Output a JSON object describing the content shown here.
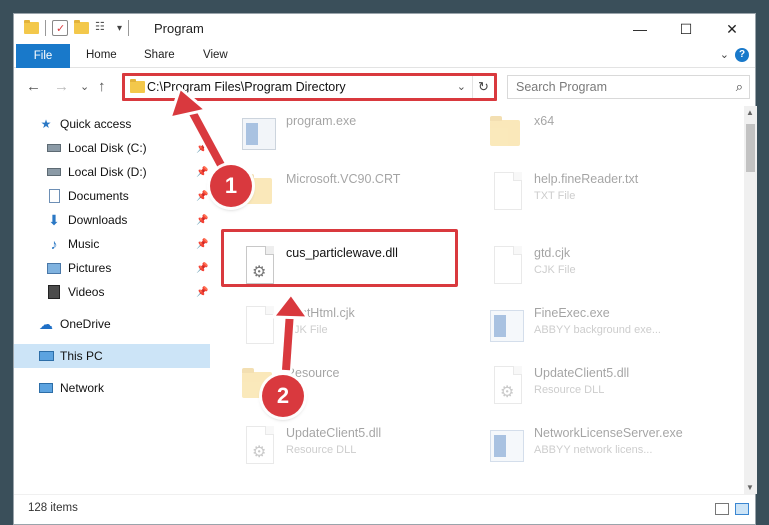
{
  "window": {
    "title": "Program",
    "minimize": "—",
    "maximize": "☐",
    "close": "✕"
  },
  "ribbon": {
    "file": "File",
    "tabs": [
      "Home",
      "Share",
      "View"
    ],
    "collapse": "⌄",
    "help": "?"
  },
  "address": {
    "path": "C:\\Program Files\\Program Directory",
    "back": "←",
    "forward": "→",
    "recent": "⌄",
    "up": "↑",
    "dropdown": "⌄",
    "refresh": "↻"
  },
  "search": {
    "placeholder": "Search Program",
    "icon": "search-icon"
  },
  "sidebar": {
    "items": [
      {
        "label": "Quick access",
        "icon": "star-icon",
        "pinned": false
      },
      {
        "label": "Local Disk (C:)",
        "icon": "drive-icon",
        "pinned": true
      },
      {
        "label": "Local Disk (D:)",
        "icon": "drive-icon",
        "pinned": true
      },
      {
        "label": "Documents",
        "icon": "documents-icon",
        "pinned": true
      },
      {
        "label": "Downloads",
        "icon": "download-icon",
        "pinned": true
      },
      {
        "label": "Music",
        "icon": "music-icon",
        "pinned": true
      },
      {
        "label": "Pictures",
        "icon": "pictures-icon",
        "pinned": true
      },
      {
        "label": "Videos",
        "icon": "videos-icon",
        "pinned": true
      },
      {
        "label": "OneDrive",
        "icon": "cloud-icon",
        "pinned": false
      },
      {
        "label": "This PC",
        "icon": "computer-icon",
        "pinned": false,
        "selected": true
      },
      {
        "label": "Network",
        "icon": "network-icon",
        "pinned": false
      }
    ]
  },
  "files": [
    {
      "name": "program.exe",
      "subtitle": "",
      "icon": "app-icon"
    },
    {
      "name": "x64",
      "subtitle": "",
      "icon": "folder-icon"
    },
    {
      "name": "Microsoft.VC90.CRT",
      "subtitle": "",
      "icon": "folder-icon"
    },
    {
      "name": "help.fineReader.txt",
      "subtitle": "TXT File",
      "icon": "document-icon"
    },
    {
      "name": "cus_particlewave.dll",
      "subtitle": "",
      "icon": "dll-icon"
    },
    {
      "name": "gtd.cjk",
      "subtitle": "CJK File",
      "icon": "document-icon"
    },
    {
      "name": "FastHtml.cjk",
      "subtitle": "CJK File",
      "icon": "document-icon"
    },
    {
      "name": "FineExec.exe",
      "subtitle": "ABBYY background exe...",
      "icon": "app-icon"
    },
    {
      "name": "Resource",
      "subtitle": "",
      "icon": "folder-icon"
    },
    {
      "name": "UpdateClient5.dll",
      "subtitle": "Resource DLL",
      "icon": "dll-icon"
    },
    {
      "name": "UpdateClient5.dll",
      "subtitle": "Resource DLL",
      "icon": "dll-icon"
    },
    {
      "name": "NetworkLicenseServer.exe",
      "subtitle": "ABBYY network licens...",
      "icon": "app-icon"
    }
  ],
  "annotations": {
    "step1": "1",
    "step2": "2",
    "color": "#d9393e"
  },
  "status": {
    "count": "128 items"
  }
}
